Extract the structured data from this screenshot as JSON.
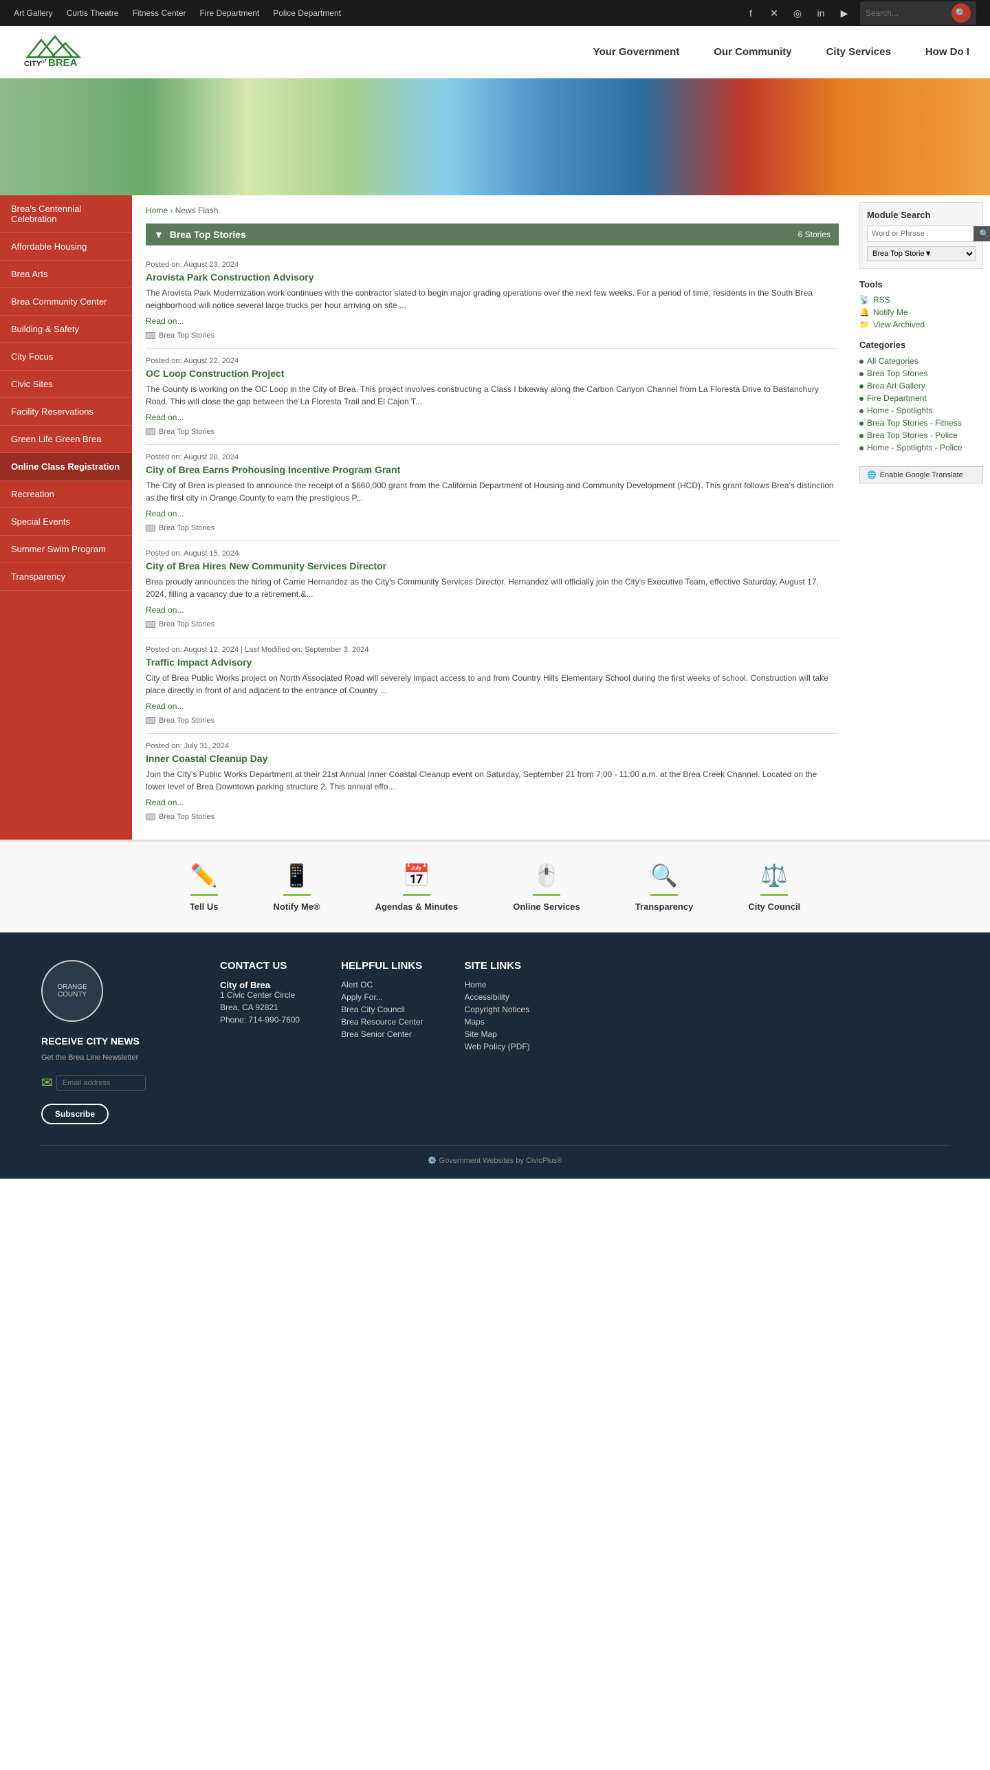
{
  "topbar": {
    "links": [
      "Art Gallery",
      "Curtis Theatre",
      "Fitness Center",
      "Fire Department",
      "Police Department"
    ],
    "search_placeholder": "Search..."
  },
  "header": {
    "logo_text": "CITY of BREA",
    "nav": [
      "Your Government",
      "Our Community",
      "City Services",
      "How Do I"
    ]
  },
  "breadcrumb": {
    "home": "Home",
    "separator": "›",
    "current": "News Flash"
  },
  "sidebar": {
    "items": [
      "Brea's Centennial Celebration",
      "Affordable Housing",
      "Brea Arts",
      "Brea Community Center",
      "Building & Safety",
      "City Focus",
      "Civic Sites",
      "Facility Reservations",
      "Green Life Green Brea",
      "Online Class Registration",
      "Recreation",
      "Special Events",
      "Summer Swim Program",
      "Transparency"
    ]
  },
  "news_section": {
    "title": "Brea Top Stories",
    "count_label": "6 Stories",
    "items": [
      {
        "date": "Posted on: August 23, 2024",
        "title": "Arovista Park Construction Advisory",
        "excerpt": "The Arovista Park Modernization work continues with the contractor slated to begin major grading operations over the next few weeks. For a period of time, residents in the South Brea neighborhood will notice several large trucks per hour arriving on site ...",
        "read_on": "Read on...",
        "category": "Brea Top Stories"
      },
      {
        "date": "Posted on: August 22, 2024",
        "title": "OC Loop Construction Project",
        "excerpt": "The County is working on the OC Loop in the City of Brea. This project involves constructing a Class I bikeway along the Carbon Canyon Channel from La Floresta Drive to Bastanchury Road. This will close the gap between the La Floresta Trail and El Cajon T...",
        "read_on": "Read on...",
        "category": "Brea Top Stories"
      },
      {
        "date": "Posted on: August 20, 2024",
        "title": "City of Brea Earns Prohousing Incentive Program Grant",
        "excerpt": "The City of Brea is pleased to announce the receipt of a $660,000 grant from the California Department of Housing and Community Development (HCD). This grant follows Brea's distinction as the first city in Orange County to earn the prestigious P...",
        "read_on": "Read on...",
        "category": "Brea Top Stories"
      },
      {
        "date": "Posted on: August 15, 2024",
        "title": "City of Brea Hires New Community Services Director",
        "excerpt": "Brea proudly announces the hiring of Carrie Hernandez as the City's Community Services Director. Hernandez will officially join the City's Executive Team, effective Saturday, August 17, 2024, filling a vacancy due to a retirement.&...",
        "read_on": "Read on...",
        "category": "Brea Top Stories"
      },
      {
        "date": "Posted on: August 12, 2024 | Last Modified on: September 3, 2024",
        "title": "Traffic Impact Advisory",
        "excerpt": "City of Brea Public Works project on North Associated Road will severely impact access to and from Country Hills Elementary School during the first weeks of school. Construction will take place directly in front of and adjacent to the entrance of Country ...",
        "read_on": "Read on...",
        "category": "Brea Top Stories"
      },
      {
        "date": "Posted on: July 31, 2024",
        "title": "Inner Coastal Cleanup Day",
        "excerpt": "Join the City's Public Works Department at their 21st Annual Inner Coastal Cleanup event on Saturday, September 21 from 7:00 - 11:00 a.m. at the Brea Creek Channel. Located on the lower level of Brea Downtown parking structure 2. This annual effo...",
        "read_on": "Read on...",
        "category": "Brea Top Stories"
      }
    ]
  },
  "module_search": {
    "title": "Module Search",
    "placeholder": "Word or Phrase",
    "button": "🔍",
    "select_default": "Brea Top Storie▼"
  },
  "tools": {
    "title": "Tools",
    "items": [
      "RSS",
      "Notify Me",
      "View Archived"
    ]
  },
  "categories": {
    "title": "Categories",
    "items": [
      "All Categories",
      "Brea Top Stories",
      "Brea Art Gallery",
      "Fire Department",
      "Home - Spotlights",
      "Brea Top Stories - Fitness",
      "Brea Top Stories - Police",
      "Home - Spotlights - Police"
    ]
  },
  "translate": {
    "label": "Enable Google Translate"
  },
  "quick_links": [
    {
      "icon": "✏️",
      "label": "Tell Us"
    },
    {
      "icon": "📱",
      "label": "Notify Me®"
    },
    {
      "icon": "📅",
      "label": "Agendas & Minutes"
    },
    {
      "icon": "🖱️",
      "label": "Online Services"
    },
    {
      "icon": "🔍",
      "label": "Transparency"
    },
    {
      "icon": "⚖️",
      "label": "City Council"
    }
  ],
  "footer": {
    "logo_text": "ORANGE COUNTY",
    "receive_news_title": "RECEIVE CITY NEWS",
    "receive_news_sub": "Get the Brea Line Newsletter",
    "subscribe_label": "Subscribe",
    "contact": {
      "title": "CONTACT US",
      "city": "City of Brea",
      "address1": "1 Civic Center Circle",
      "address2": "Brea, CA 92821",
      "phone": "Phone: 714-990-7600"
    },
    "helpful_links": {
      "title": "HELPFUL LINKS",
      "items": [
        "Alert OC",
        "Apply For...",
        "Brea City Council",
        "Brea Resource Center",
        "Brea Senior Center"
      ]
    },
    "site_links": {
      "title": "SITE LINKS",
      "items": [
        "Home",
        "Accessibility",
        "Copyright Notices",
        "Maps",
        "Site Map",
        "Web Policy (PDF)"
      ]
    },
    "bottom": "Government Websites by CivicPlus®"
  }
}
